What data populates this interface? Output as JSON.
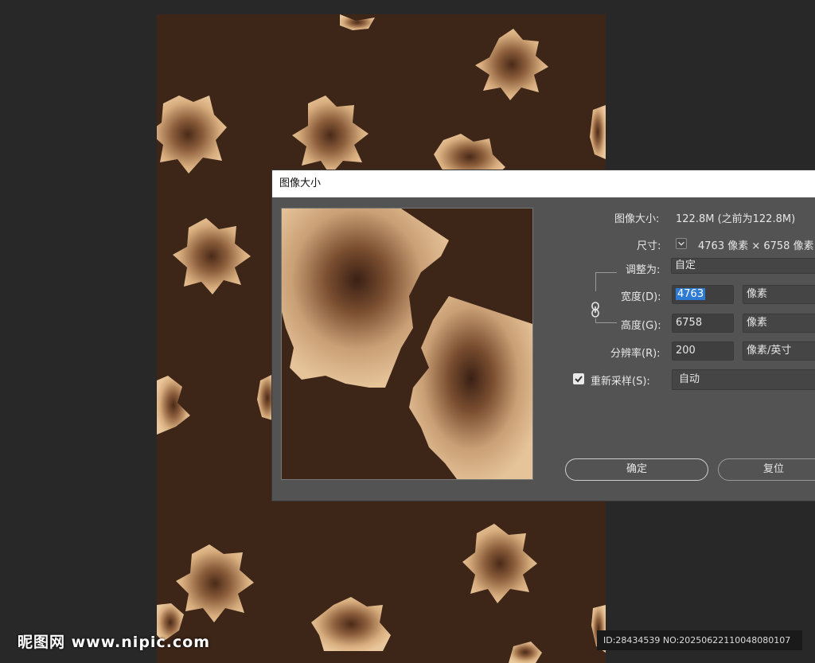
{
  "dialog": {
    "title": "图像大小",
    "image_size_label": "图像大小:",
    "image_size_value": "122.8M (之前为122.8M)",
    "dimensions_label": "尺寸:",
    "dimensions_value": "4763 像素 × 6758 像素",
    "fit_to_label": "调整为:",
    "fit_to_value": "自定",
    "width_label": "宽度(D):",
    "width_value": "4763",
    "width_unit": "像素",
    "height_label": "高度(G):",
    "height_value": "6758",
    "height_unit": "像素",
    "resolution_label": "分辨率(R):",
    "resolution_value": "200",
    "resolution_unit": "像素/英寸",
    "resample_label": "重新采样(S):",
    "resample_checked": true,
    "resample_value": "自动",
    "ok_label": "确定",
    "reset_label": "复位"
  },
  "watermark": {
    "site": "昵图网 www.nipic.com",
    "id_text": "ID:28434539 NO:20250622110048080107"
  },
  "colors": {
    "background": "#282828",
    "canvas": "#3d2518",
    "dialog": "#535353",
    "petal": "#e0b888",
    "selection": "#2e7bd6"
  },
  "icons": {
    "dimension_toggle": "chevron-down-icon",
    "constrain": "chain-link-icon",
    "resample_check": "checkmark-icon"
  }
}
